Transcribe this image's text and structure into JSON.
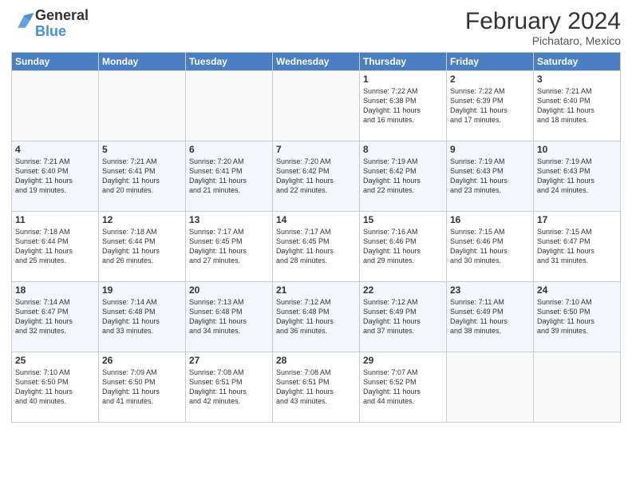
{
  "logo": {
    "text_general": "General",
    "text_blue": "Blue"
  },
  "header": {
    "title": "February 2024",
    "subtitle": "Pichataro, Mexico"
  },
  "days_of_week": [
    "Sunday",
    "Monday",
    "Tuesday",
    "Wednesday",
    "Thursday",
    "Friday",
    "Saturday"
  ],
  "weeks": [
    [
      {
        "day": "",
        "info": ""
      },
      {
        "day": "",
        "info": ""
      },
      {
        "day": "",
        "info": ""
      },
      {
        "day": "",
        "info": ""
      },
      {
        "day": "1",
        "info": "Sunrise: 7:22 AM\nSunset: 6:38 PM\nDaylight: 11 hours\nand 16 minutes."
      },
      {
        "day": "2",
        "info": "Sunrise: 7:22 AM\nSunset: 6:39 PM\nDaylight: 11 hours\nand 17 minutes."
      },
      {
        "day": "3",
        "info": "Sunrise: 7:21 AM\nSunset: 6:40 PM\nDaylight: 11 hours\nand 18 minutes."
      }
    ],
    [
      {
        "day": "4",
        "info": "Sunrise: 7:21 AM\nSunset: 6:40 PM\nDaylight: 11 hours\nand 19 minutes."
      },
      {
        "day": "5",
        "info": "Sunrise: 7:21 AM\nSunset: 6:41 PM\nDaylight: 11 hours\nand 20 minutes."
      },
      {
        "day": "6",
        "info": "Sunrise: 7:20 AM\nSunset: 6:41 PM\nDaylight: 11 hours\nand 21 minutes."
      },
      {
        "day": "7",
        "info": "Sunrise: 7:20 AM\nSunset: 6:42 PM\nDaylight: 11 hours\nand 22 minutes."
      },
      {
        "day": "8",
        "info": "Sunrise: 7:19 AM\nSunset: 6:42 PM\nDaylight: 11 hours\nand 22 minutes."
      },
      {
        "day": "9",
        "info": "Sunrise: 7:19 AM\nSunset: 6:43 PM\nDaylight: 11 hours\nand 23 minutes."
      },
      {
        "day": "10",
        "info": "Sunrise: 7:19 AM\nSunset: 6:43 PM\nDaylight: 11 hours\nand 24 minutes."
      }
    ],
    [
      {
        "day": "11",
        "info": "Sunrise: 7:18 AM\nSunset: 6:44 PM\nDaylight: 11 hours\nand 25 minutes."
      },
      {
        "day": "12",
        "info": "Sunrise: 7:18 AM\nSunset: 6:44 PM\nDaylight: 11 hours\nand 26 minutes."
      },
      {
        "day": "13",
        "info": "Sunrise: 7:17 AM\nSunset: 6:45 PM\nDaylight: 11 hours\nand 27 minutes."
      },
      {
        "day": "14",
        "info": "Sunrise: 7:17 AM\nSunset: 6:45 PM\nDaylight: 11 hours\nand 28 minutes."
      },
      {
        "day": "15",
        "info": "Sunrise: 7:16 AM\nSunset: 6:46 PM\nDaylight: 11 hours\nand 29 minutes."
      },
      {
        "day": "16",
        "info": "Sunrise: 7:15 AM\nSunset: 6:46 PM\nDaylight: 11 hours\nand 30 minutes."
      },
      {
        "day": "17",
        "info": "Sunrise: 7:15 AM\nSunset: 6:47 PM\nDaylight: 11 hours\nand 31 minutes."
      }
    ],
    [
      {
        "day": "18",
        "info": "Sunrise: 7:14 AM\nSunset: 6:47 PM\nDaylight: 11 hours\nand 32 minutes."
      },
      {
        "day": "19",
        "info": "Sunrise: 7:14 AM\nSunset: 6:48 PM\nDaylight: 11 hours\nand 33 minutes."
      },
      {
        "day": "20",
        "info": "Sunrise: 7:13 AM\nSunset: 6:48 PM\nDaylight: 11 hours\nand 34 minutes."
      },
      {
        "day": "21",
        "info": "Sunrise: 7:12 AM\nSunset: 6:48 PM\nDaylight: 11 hours\nand 36 minutes."
      },
      {
        "day": "22",
        "info": "Sunrise: 7:12 AM\nSunset: 6:49 PM\nDaylight: 11 hours\nand 37 minutes."
      },
      {
        "day": "23",
        "info": "Sunrise: 7:11 AM\nSunset: 6:49 PM\nDaylight: 11 hours\nand 38 minutes."
      },
      {
        "day": "24",
        "info": "Sunrise: 7:10 AM\nSunset: 6:50 PM\nDaylight: 11 hours\nand 39 minutes."
      }
    ],
    [
      {
        "day": "25",
        "info": "Sunrise: 7:10 AM\nSunset: 6:50 PM\nDaylight: 11 hours\nand 40 minutes."
      },
      {
        "day": "26",
        "info": "Sunrise: 7:09 AM\nSunset: 6:50 PM\nDaylight: 11 hours\nand 41 minutes."
      },
      {
        "day": "27",
        "info": "Sunrise: 7:08 AM\nSunset: 6:51 PM\nDaylight: 11 hours\nand 42 minutes."
      },
      {
        "day": "28",
        "info": "Sunrise: 7:08 AM\nSunset: 6:51 PM\nDaylight: 11 hours\nand 43 minutes."
      },
      {
        "day": "29",
        "info": "Sunrise: 7:07 AM\nSunset: 6:52 PM\nDaylight: 11 hours\nand 44 minutes."
      },
      {
        "day": "",
        "info": ""
      },
      {
        "day": "",
        "info": ""
      }
    ]
  ]
}
